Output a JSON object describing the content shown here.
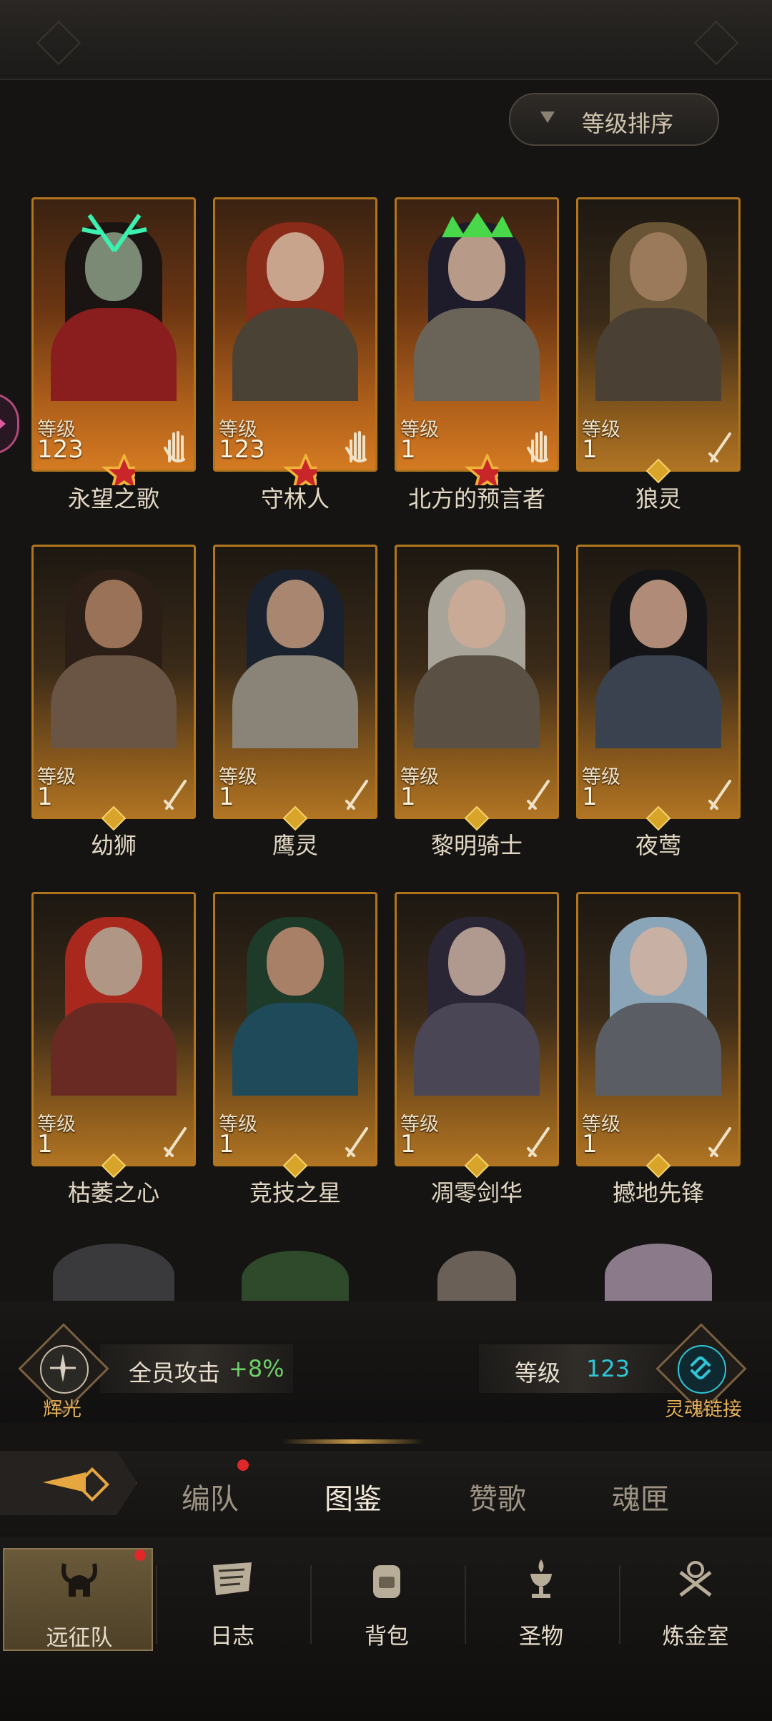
{
  "header": {
    "sort_label": "等级排序"
  },
  "heroes": [
    {
      "name": "永望之歌",
      "level_label": "等级",
      "level": "123"
    },
    {
      "name": "守林人",
      "level_label": "等级",
      "level": "123"
    },
    {
      "name": "北方的预言者",
      "level_label": "等级",
      "level": "1"
    },
    {
      "name": "狼灵",
      "level_label": "等级",
      "level": "1"
    },
    {
      "name": "幼狮",
      "level_label": "等级",
      "level": "1"
    },
    {
      "name": "鹰灵",
      "level_label": "等级",
      "level": "1"
    },
    {
      "name": "黎明骑士",
      "level_label": "等级",
      "level": "1"
    },
    {
      "name": "夜莺",
      "level_label": "等级",
      "level": "1"
    },
    {
      "name": "枯萎之心",
      "level_label": "等级",
      "level": "1"
    },
    {
      "name": "竞技之星",
      "level_label": "等级",
      "level": "1"
    },
    {
      "name": "凋零剑华",
      "level_label": "等级",
      "level": "1"
    },
    {
      "name": "撼地先锋",
      "level_label": "等级",
      "level": "1"
    }
  ],
  "stats": {
    "left_emblem_label": "辉光",
    "attack_label": "全员攻击",
    "attack_value": "+8%",
    "level_label": "等级",
    "level_value": "123",
    "right_emblem_label": "灵魂链接"
  },
  "subtabs": [
    "编队",
    "图鉴",
    "赞歌",
    "魂匣"
  ],
  "nav": [
    "远征队",
    "日志",
    "背包",
    "圣物",
    "炼金室"
  ],
  "colors": {
    "accent_gold": "#e6a640",
    "green": "#6ed06a",
    "cyan": "#2ec6d8",
    "notify_red": "#e02828"
  }
}
